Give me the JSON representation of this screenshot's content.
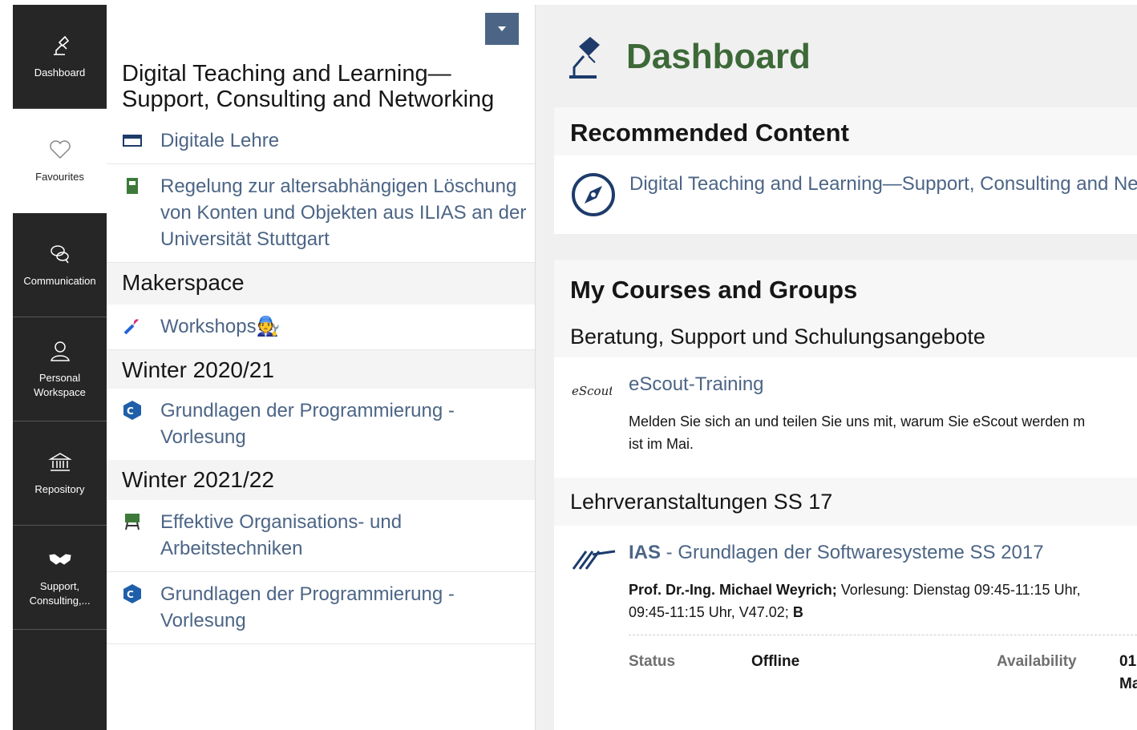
{
  "mainbar": {
    "items": [
      {
        "label": "Dashboard",
        "icon": "lamp-icon"
      },
      {
        "label": "Favourites",
        "icon": "heart-icon"
      },
      {
        "label": "Communication",
        "icon": "chat-bubbles-icon"
      },
      {
        "label": "Personal\nWorkspace",
        "icon": "person-icon"
      },
      {
        "label": "Repository",
        "icon": "bank-icon"
      },
      {
        "label": "Support,\nConsulting,...",
        "icon": "handshake-icon"
      }
    ]
  },
  "slate": {
    "title": "Digital Teaching and Learning—Support, Consulting and Networking",
    "items": [
      {
        "label": "Digitale Lehre",
        "icon": "category-icon"
      },
      {
        "label": "Regelung zur altersabhängigen Löschung von Konten und Objekten aus ILIAS an der Universität Stuttgart",
        "icon": "file-icon"
      }
    ],
    "groups": [
      {
        "title": "Makerspace",
        "items": [
          {
            "label": "Workshops🧑‍🔧",
            "icon": "wrench-icon"
          }
        ]
      },
      {
        "title": "Winter 2020/21",
        "items": [
          {
            "label": "Grundlagen der Programmierung - Vorlesung",
            "icon": "cpp-icon"
          }
        ]
      },
      {
        "title": "Winter 2021/22",
        "items": [
          {
            "label": "Effektive Organisations- und Arbeitstechniken",
            "icon": "classroom-icon"
          },
          {
            "label": "Grundlagen der Programmierung - Vorlesung",
            "icon": "cpp-icon"
          }
        ]
      }
    ]
  },
  "page": {
    "title": "Dashboard"
  },
  "recommended": {
    "heading": "Recommended Content",
    "item": "Digital Teaching and Learning—Support, Consulting and Net"
  },
  "courses": {
    "heading": "My Courses and Groups",
    "groups": [
      {
        "title": "Beratung, Support und Schulungsangebote",
        "course": {
          "title": "eScout-Training",
          "icon_text": "eScouts",
          "desc_line1": "Melden Sie sich an und teilen Sie uns mit, warum Sie eScout werden m",
          "desc_line2": "ist im Mai."
        }
      },
      {
        "title": "Lehrveranstaltungen SS 17",
        "course": {
          "prefix": "IAS",
          "title": " - Grundlagen der Softwaresysteme SS 2017",
          "desc_bold": "Prof. Dr.-Ing. Michael Weyrich;",
          "desc_rest": " Vorlesung: Dienstag 09:45-11:15 Uhr,",
          "desc_line2": "09:45-11:15 Uhr, V47.02; ",
          "desc_line2_bold": "B",
          "status_label": "Status",
          "status_value": "Offline",
          "availability_label": "Availability",
          "availability_value1": "01",
          "availability_value2": "Ma"
        }
      }
    ]
  },
  "colors": {
    "link": "#4c6586",
    "title_green": "#3d6938",
    "mainbar": "#262626"
  }
}
